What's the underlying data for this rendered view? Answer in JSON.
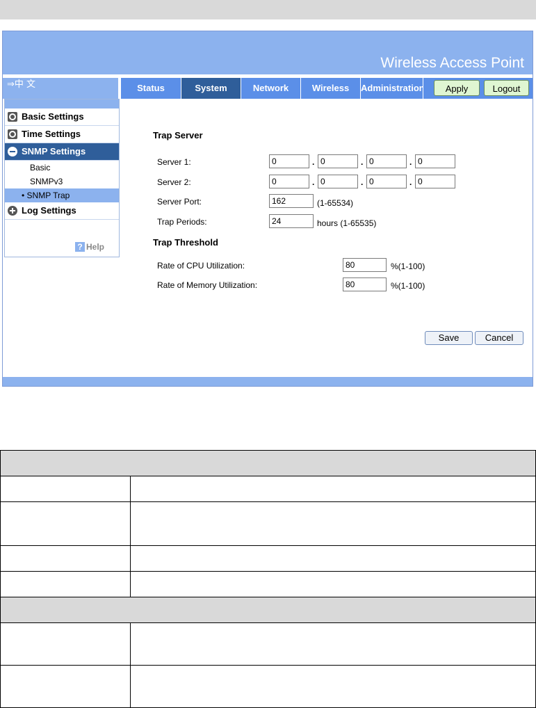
{
  "header": {
    "title": "Wireless Access Point",
    "lang_link": "⇒中 文"
  },
  "tabs": [
    "Status",
    "System",
    "Network",
    "Wireless",
    "Administration"
  ],
  "active_tab": "System",
  "top_buttons": {
    "apply": "Apply",
    "logout": "Logout"
  },
  "sidebar": {
    "menus": {
      "basic": "Basic Settings",
      "time": "Time Settings",
      "snmp": "SNMP Settings",
      "log": "Log Settings"
    },
    "snmp_sub": [
      "Basic",
      "SNMPv3",
      "• SNMP Trap"
    ],
    "help": "Help"
  },
  "trap_server": {
    "heading": "Trap Server",
    "server1_label": "Server 1:",
    "server1": [
      "0",
      "0",
      "0",
      "0"
    ],
    "server2_label": "Server 2:",
    "server2": [
      "0",
      "0",
      "0",
      "0"
    ],
    "port_label": "Server Port:",
    "port": "162",
    "port_hint": "(1-65534)",
    "periods_label": "Trap Periods:",
    "periods": "24",
    "periods_hint": "hours (1-65535)"
  },
  "trap_threshold": {
    "heading": "Trap Threshold",
    "cpu_label": "Rate of CPU Utilization:",
    "cpu": "80",
    "cpu_hint": "%(1-100)",
    "mem_label": "Rate of Memory Utilization:",
    "mem": "80",
    "mem_hint": "%(1-100)"
  },
  "form_buttons": {
    "save": "Save",
    "cancel": "Cancel"
  }
}
